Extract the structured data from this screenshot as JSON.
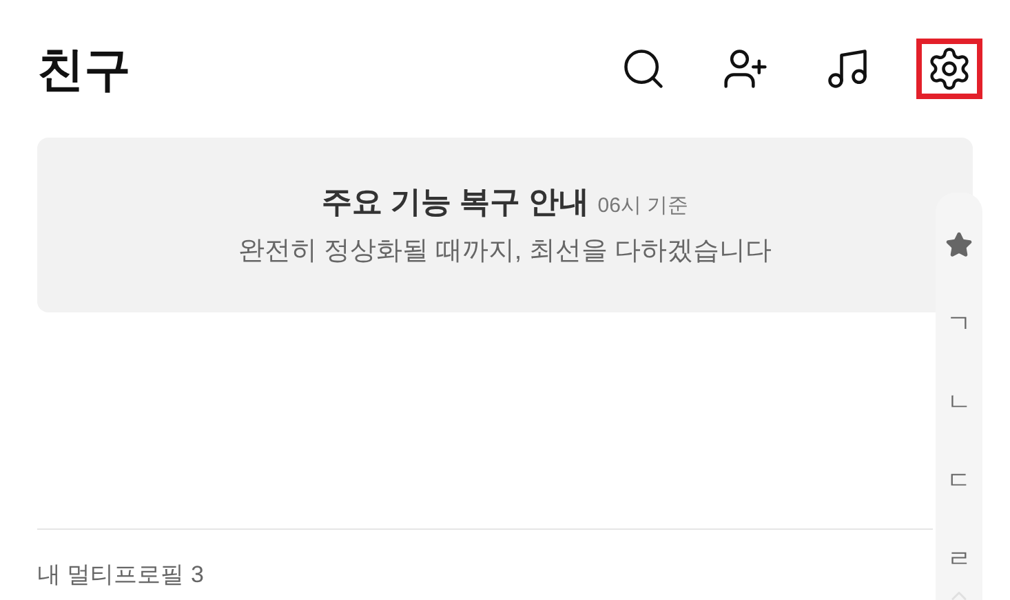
{
  "header": {
    "title": "친구",
    "actions": [
      {
        "kind": "search",
        "highlighted": false
      },
      {
        "kind": "add-friend",
        "highlighted": false
      },
      {
        "kind": "music",
        "highlighted": false
      },
      {
        "kind": "settings",
        "highlighted": true
      }
    ]
  },
  "notice": {
    "title": "주요 기능 복구 안내",
    "time": "06시 기준",
    "message": "완전히 정상화될 때까지, 최선을 다하겠습니다"
  },
  "section": {
    "label": "내 멀티프로필 3"
  },
  "index_bar": [
    {
      "kind": "star"
    },
    {
      "kind": "letter",
      "text": "ㄱ"
    },
    {
      "kind": "letter",
      "text": "ㄴ"
    },
    {
      "kind": "letter",
      "text": "ㄷ"
    },
    {
      "kind": "letter",
      "text": "ㄹ"
    }
  ]
}
